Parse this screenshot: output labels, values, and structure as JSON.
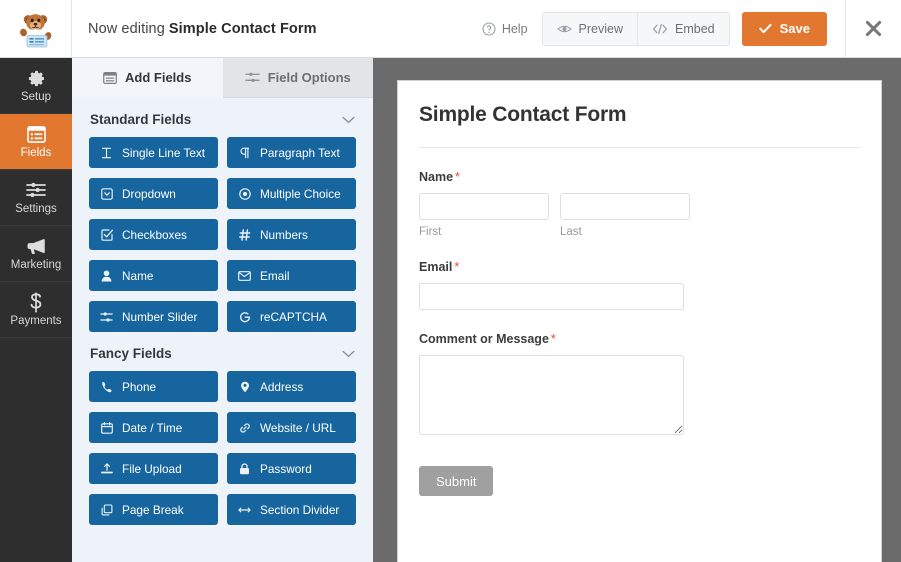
{
  "header": {
    "logo_name": "wpforms-bear-logo",
    "editing_prefix": "Now editing",
    "form_name": "Simple Contact Form",
    "help_label": "Help",
    "preview_label": "Preview",
    "embed_label": "Embed",
    "save_label": "Save",
    "close_label": "✕"
  },
  "rail": {
    "items": [
      {
        "label": "Setup",
        "icon": "gear-icon",
        "active": false
      },
      {
        "label": "Fields",
        "icon": "fields-list-icon",
        "active": true
      },
      {
        "label": "Settings",
        "icon": "sliders-icon",
        "active": false
      },
      {
        "label": "Marketing",
        "icon": "megaphone-icon",
        "active": false
      },
      {
        "label": "Payments",
        "icon": "dollar-icon",
        "active": false
      }
    ]
  },
  "panel": {
    "tabs": [
      {
        "label": "Add Fields",
        "icon": "add-fields-icon",
        "active": true
      },
      {
        "label": "Field Options",
        "icon": "field-options-icon",
        "active": false
      }
    ],
    "sections": [
      {
        "title": "Standard Fields",
        "collapse_icon": "chevron-down-icon",
        "fields": [
          {
            "label": "Single Line Text",
            "icon": "text-cursor-icon"
          },
          {
            "label": "Paragraph Text",
            "icon": "pilcrow-icon"
          },
          {
            "label": "Dropdown",
            "icon": "dropdown-icon"
          },
          {
            "label": "Multiple Choice",
            "icon": "radio-icon"
          },
          {
            "label": "Checkboxes",
            "icon": "checkbox-icon"
          },
          {
            "label": "Numbers",
            "icon": "hash-icon"
          },
          {
            "label": "Name",
            "icon": "person-icon"
          },
          {
            "label": "Email",
            "icon": "envelope-icon"
          },
          {
            "label": "Number Slider",
            "icon": "slider-icon"
          },
          {
            "label": "reCAPTCHA",
            "icon": "google-g-icon"
          }
        ]
      },
      {
        "title": "Fancy Fields",
        "collapse_icon": "chevron-down-icon",
        "fields": [
          {
            "label": "Phone",
            "icon": "phone-icon"
          },
          {
            "label": "Address",
            "icon": "map-pin-icon"
          },
          {
            "label": "Date / Time",
            "icon": "calendar-icon"
          },
          {
            "label": "Website / URL",
            "icon": "link-icon"
          },
          {
            "label": "File Upload",
            "icon": "upload-icon"
          },
          {
            "label": "Password",
            "icon": "lock-icon"
          },
          {
            "label": "Page Break",
            "icon": "page-break-icon"
          },
          {
            "label": "Section Divider",
            "icon": "arrows-horizontal-icon"
          }
        ]
      }
    ]
  },
  "preview": {
    "title": "Simple Contact Form",
    "fields": {
      "name": {
        "label": "Name",
        "required_marker": "*",
        "first_value": "",
        "last_value": "",
        "first_sub_label": "First",
        "last_sub_label": "Last"
      },
      "email": {
        "label": "Email",
        "required_marker": "*",
        "value": ""
      },
      "comment": {
        "label": "Comment or Message",
        "required_marker": "*",
        "value": ""
      }
    },
    "submit_label": "Submit"
  },
  "colors": {
    "accent_orange": "#e27730",
    "field_blue": "#17659e",
    "rail_dark": "#2e2e2e",
    "panel_bg": "#eef3f9",
    "required_red": "#e04a3f",
    "submit_gray": "#a0a0a0"
  }
}
